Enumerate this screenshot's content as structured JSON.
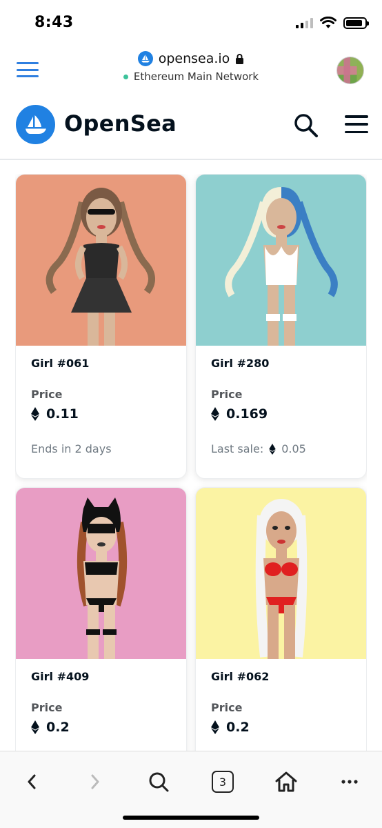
{
  "status_bar": {
    "time": "8:43"
  },
  "browser": {
    "domain": "opensea.io",
    "network": "Ethereum Main Network",
    "icons": {
      "menu": "hamburger-icon",
      "lock": "lock-icon",
      "avatar": "account-avatar"
    }
  },
  "header": {
    "brand": "OpenSea",
    "icons": {
      "logo": "opensea-sailboat-logo",
      "search": "search-icon",
      "menu": "hamburger-icon"
    },
    "accent_color": "#2081E2"
  },
  "cards": [
    {
      "name": "Girl #061",
      "price_label": "Price",
      "price": "0.11",
      "footnote": "Ends in 2 days",
      "footnote_value": "",
      "bg_color": "#E89A7C"
    },
    {
      "name": "Girl #280",
      "price_label": "Price",
      "price": "0.169",
      "footnote": "Last sale:",
      "footnote_value": "0.05",
      "bg_color": "#8ECFCF"
    },
    {
      "name": "Girl #409",
      "price_label": "Price",
      "price": "0.2",
      "footnote": "",
      "footnote_value": "",
      "bg_color": "#E89DC4"
    },
    {
      "name": "Girl #062",
      "price_label": "Price",
      "price": "0.2",
      "footnote": "",
      "footnote_value": "",
      "bg_color": "#FBF3A3"
    }
  ],
  "toolbar": {
    "tab_count": "3",
    "icons": [
      "back-icon",
      "forward-icon",
      "search-icon",
      "tabs-icon",
      "home-icon",
      "more-icon"
    ]
  }
}
